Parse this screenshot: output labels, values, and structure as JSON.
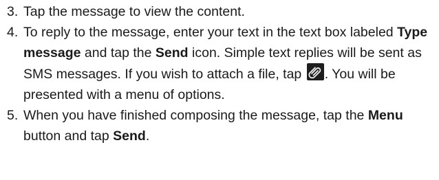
{
  "steps": [
    {
      "number": "3.",
      "text": "Tap the message to view the content."
    },
    {
      "number": "4.",
      "part1": "To reply to the message, enter your text in the text box labeled ",
      "bold1": "Type message",
      "part2": " and tap the ",
      "bold2": "Send",
      "part3": " icon. Simple text replies will be sent as SMS messages. If you wish to attach a file, tap ",
      "icon": "paperclip-icon",
      "part4": ". You will be presented with a menu of options."
    },
    {
      "number": "5.",
      "part1": "When you have finished composing the message, tap the ",
      "bold1": "Menu",
      "part2": " button and tap ",
      "bold2": "Send",
      "part3": "."
    }
  ]
}
